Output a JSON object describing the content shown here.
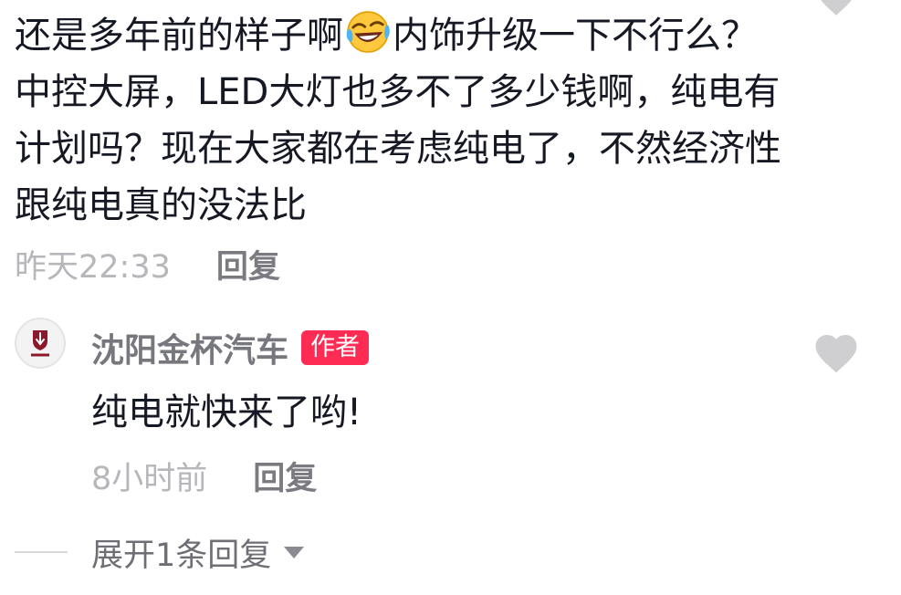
{
  "comment": {
    "text_before_emoji": "还是多年前的样子啊",
    "emoji": "laughing-crying-emoji",
    "text_after_emoji": "内饰升级一下不行么？中控大屏，LED大灯也多不了多少钱啊，纯电有计划吗？现在大家都在考虑纯电了，不然经济性跟纯电真的没法比",
    "timestamp": "昨天22:33",
    "reply_label": "回复",
    "like_icon": "heart-icon"
  },
  "reply": {
    "avatar_icon": "jinbei-logo",
    "author_name": "沈阳金杯汽车",
    "author_badge": "作者",
    "text": "纯电就快来了哟!",
    "timestamp": "8小时前",
    "reply_label": "回复",
    "like_icon": "heart-icon"
  },
  "expand": {
    "label": "展开1条回复",
    "icon": "caret-down-icon"
  },
  "colors": {
    "badge": "#fe2c55",
    "heart": "#cfcfd1",
    "muted_text": "#b7b7bb",
    "reply_label": "#7a7a80",
    "body_text": "#161823"
  }
}
